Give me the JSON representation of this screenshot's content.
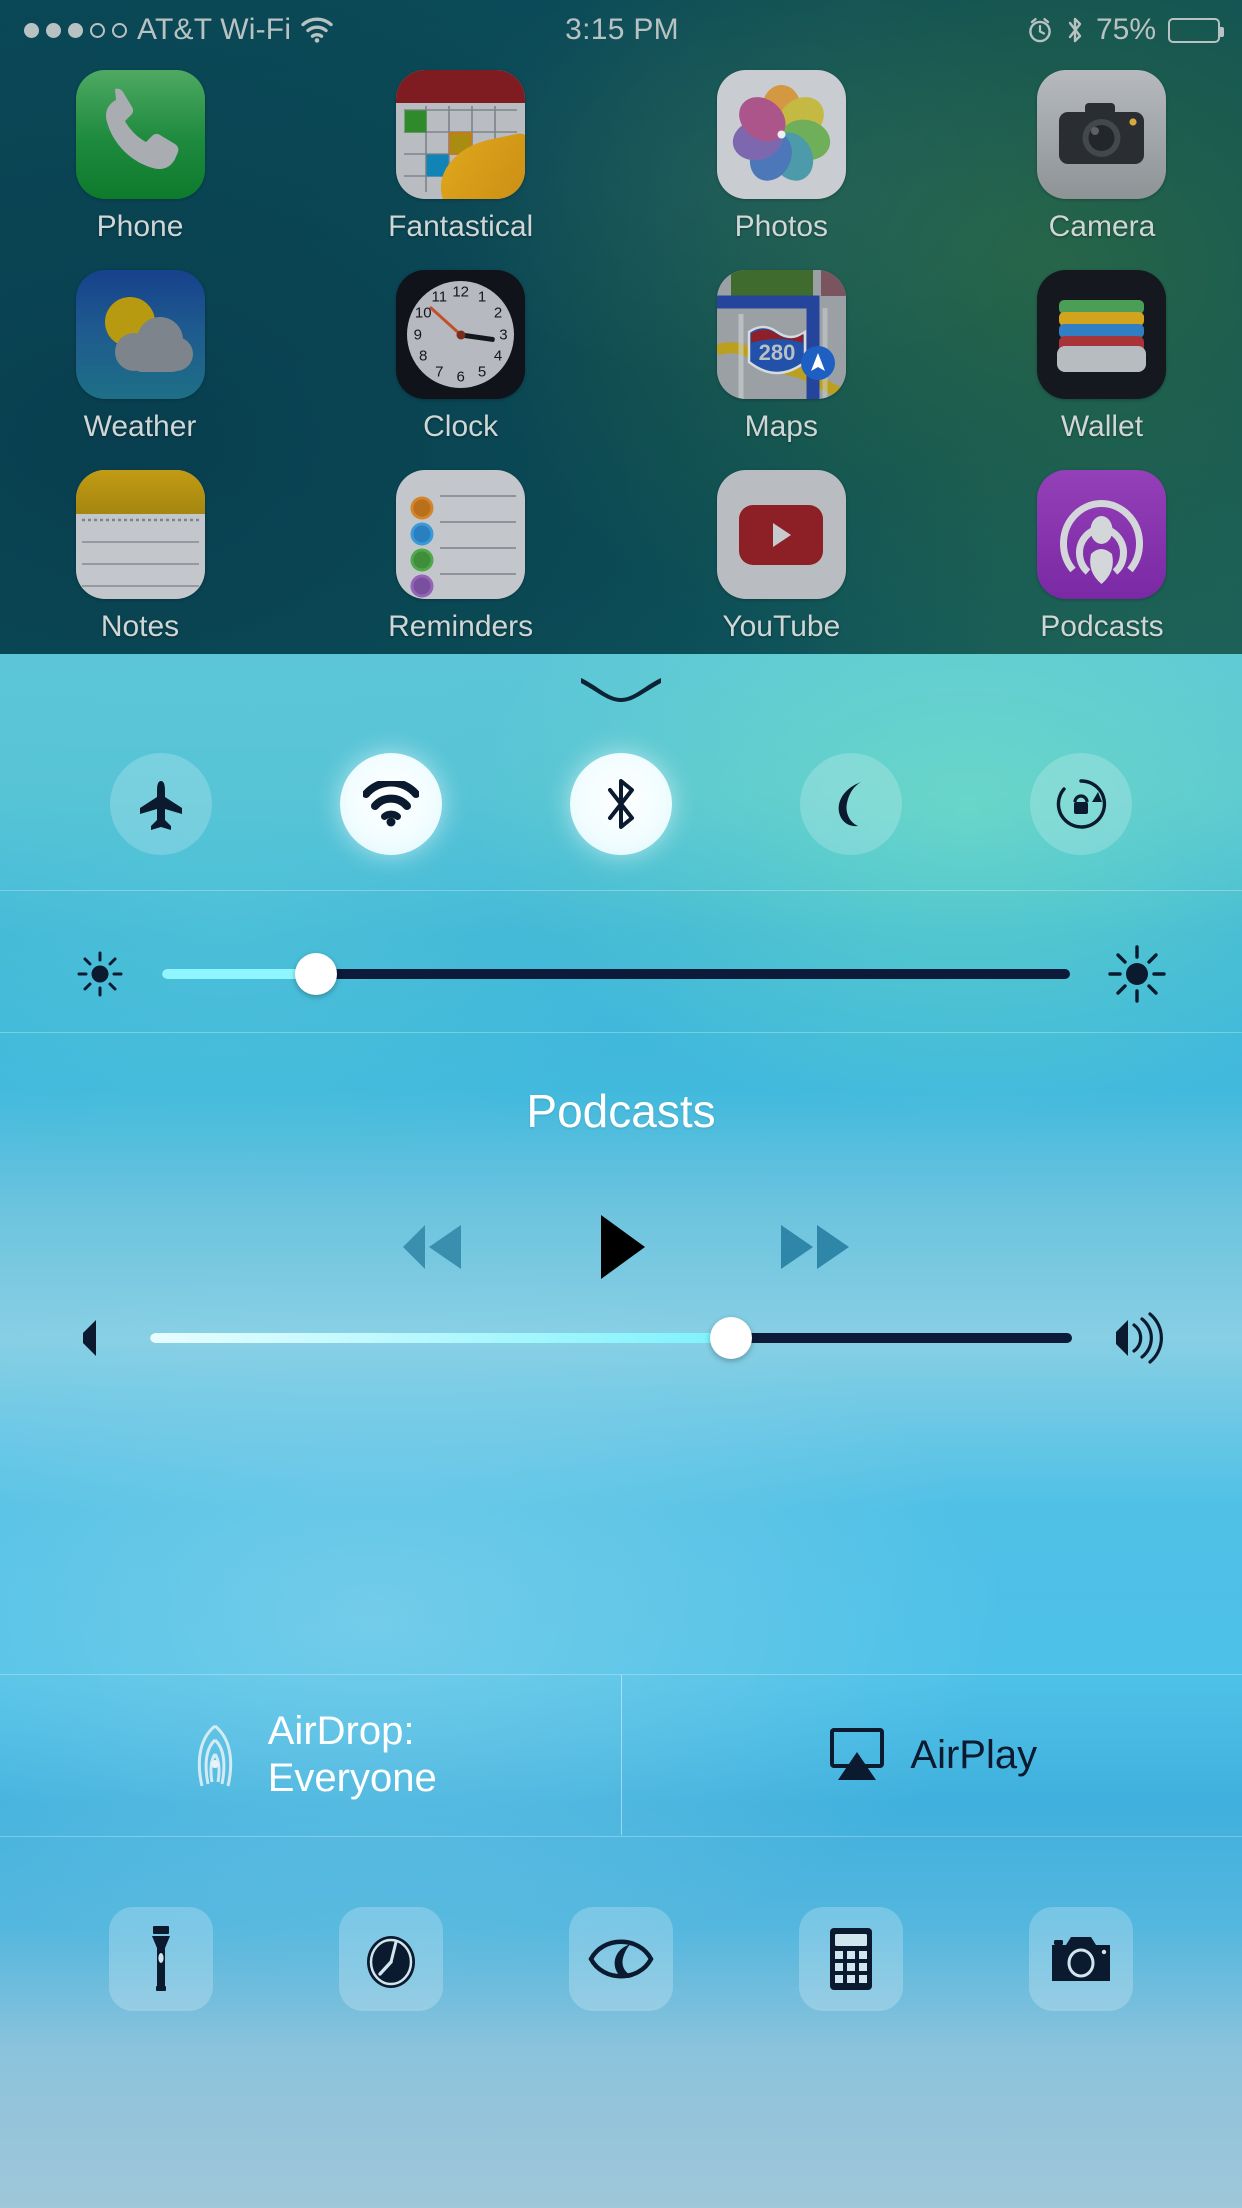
{
  "status_bar": {
    "signal_dots_filled": 3,
    "signal_dots_total": 5,
    "carrier": "AT&T Wi-Fi",
    "wifi_icon": "wifi-icon",
    "time": "3:15 PM",
    "alarm_icon": "alarm-clock-icon",
    "bluetooth_icon": "bluetooth-icon",
    "battery_percent": "75%",
    "battery_level": 75
  },
  "home_screen": {
    "rows": [
      [
        {
          "label": "Phone",
          "icon": "phone-icon"
        },
        {
          "label": "Fantastical",
          "icon": "calendar-icon"
        },
        {
          "label": "Photos",
          "icon": "photos-pinwheel-icon"
        },
        {
          "label": "Camera",
          "icon": "camera-icon"
        }
      ],
      [
        {
          "label": "Weather",
          "icon": "weather-sun-cloud-icon"
        },
        {
          "label": "Clock",
          "icon": "clock-face-icon"
        },
        {
          "label": "Maps",
          "icon": "maps-icon"
        },
        {
          "label": "Wallet",
          "icon": "wallet-cards-icon"
        }
      ],
      [
        {
          "label": "Notes",
          "icon": "notes-icon"
        },
        {
          "label": "Reminders",
          "icon": "reminders-icon"
        },
        {
          "label": "YouTube",
          "icon": "youtube-play-icon"
        },
        {
          "label": "Podcasts",
          "icon": "podcasts-icon"
        }
      ]
    ],
    "maps_highway_label": "280",
    "clock_numerals": [
      "12",
      "1",
      "2",
      "3",
      "4",
      "5",
      "6",
      "7",
      "8",
      "9",
      "10",
      "11"
    ]
  },
  "control_center": {
    "grabber": "grabber-handle",
    "toggles": [
      {
        "name": "airplane-mode",
        "icon": "airplane-icon",
        "active": false
      },
      {
        "name": "wifi",
        "icon": "wifi-icon",
        "active": true
      },
      {
        "name": "bluetooth",
        "icon": "bluetooth-icon",
        "active": true
      },
      {
        "name": "do-not-disturb",
        "icon": "moon-icon",
        "active": false
      },
      {
        "name": "rotation-lock",
        "icon": "rotation-lock-icon",
        "active": false
      }
    ],
    "brightness": {
      "label": "Brightness",
      "value_percent": 17,
      "low_icon": "brightness-low-icon",
      "high_icon": "brightness-high-icon"
    },
    "media": {
      "title": "Podcasts",
      "controls": [
        {
          "name": "rewind-button",
          "icon": "rewind-icon",
          "enabled": false
        },
        {
          "name": "play-button",
          "icon": "play-icon",
          "enabled": true
        },
        {
          "name": "fast-forward-button",
          "icon": "fast-forward-icon",
          "enabled": false
        }
      ],
      "volume": {
        "label": "Volume",
        "value_percent": 63,
        "low_icon": "volume-low-icon",
        "high_icon": "volume-high-icon"
      }
    },
    "airdrop": {
      "icon": "airdrop-icon",
      "line1": "AirDrop:",
      "line2": "Everyone"
    },
    "airplay": {
      "icon": "airplay-icon",
      "label": "AirPlay"
    },
    "shortcuts": [
      {
        "name": "flashlight-shortcut",
        "icon": "flashlight-icon"
      },
      {
        "name": "timer-shortcut",
        "icon": "timer-icon"
      },
      {
        "name": "night-shift-shortcut",
        "icon": "night-shift-eye-icon"
      },
      {
        "name": "calculator-shortcut",
        "icon": "calculator-icon"
      },
      {
        "name": "camera-shortcut",
        "icon": "camera-icon"
      }
    ]
  },
  "colors": {
    "active_toggle": "#ffffff",
    "inactive_toggle": "rgba(255,255,255,0.20)",
    "slider_track": "#0d1b3a",
    "slider_fill": "#8ff6ff",
    "cc_tint": "#4fc0e6"
  }
}
